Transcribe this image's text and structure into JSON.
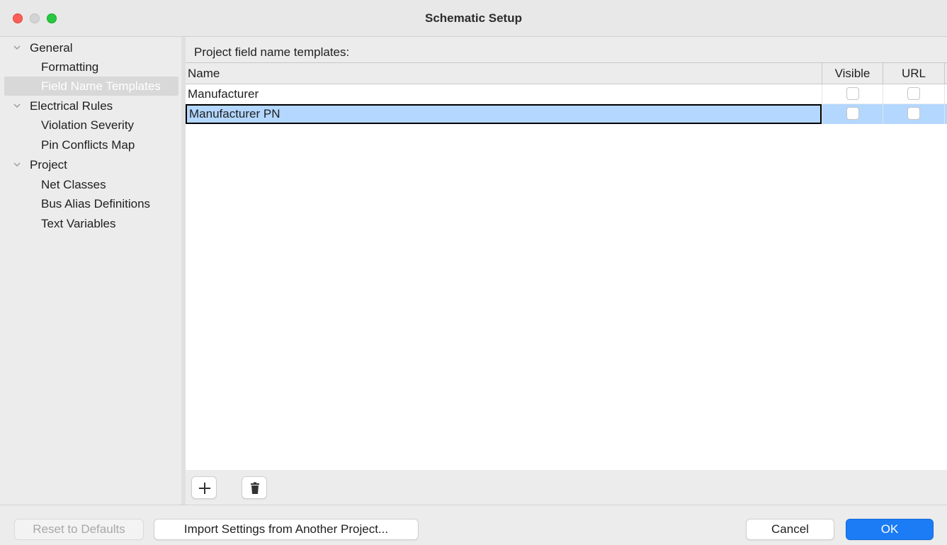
{
  "window": {
    "title": "Schematic Setup"
  },
  "sidebar": {
    "items": [
      {
        "label": "General",
        "level": 0,
        "expanded": true
      },
      {
        "label": "Formatting",
        "level": 1
      },
      {
        "label": "Field Name Templates",
        "level": 1,
        "selected": true
      },
      {
        "label": "Electrical Rules",
        "level": 0,
        "expanded": true
      },
      {
        "label": "Violation Severity",
        "level": 1
      },
      {
        "label": "Pin Conflicts Map",
        "level": 1
      },
      {
        "label": "Project",
        "level": 0,
        "expanded": true
      },
      {
        "label": "Net Classes",
        "level": 1
      },
      {
        "label": "Bus Alias Definitions",
        "level": 1
      },
      {
        "label": "Text Variables",
        "level": 1
      }
    ]
  },
  "panel": {
    "label": "Project field name templates:",
    "columns": [
      "Name",
      "Visible",
      "URL"
    ],
    "rows": [
      {
        "name": "Manufacturer",
        "visible": false,
        "url": false,
        "selected": false
      },
      {
        "name": "Manufacturer PN",
        "visible": false,
        "url": false,
        "selected": true
      }
    ],
    "toolbar": {
      "add_icon": "plus-icon",
      "delete_icon": "trash-icon"
    }
  },
  "footer": {
    "reset_label": "Reset to Defaults",
    "import_label": "Import Settings from Another Project...",
    "cancel_label": "Cancel",
    "ok_label": "OK"
  },
  "colors": {
    "selection": "#b3d7ff",
    "accent": "#1b7cf5",
    "close": "#fe5f57",
    "maximize": "#28c840"
  }
}
